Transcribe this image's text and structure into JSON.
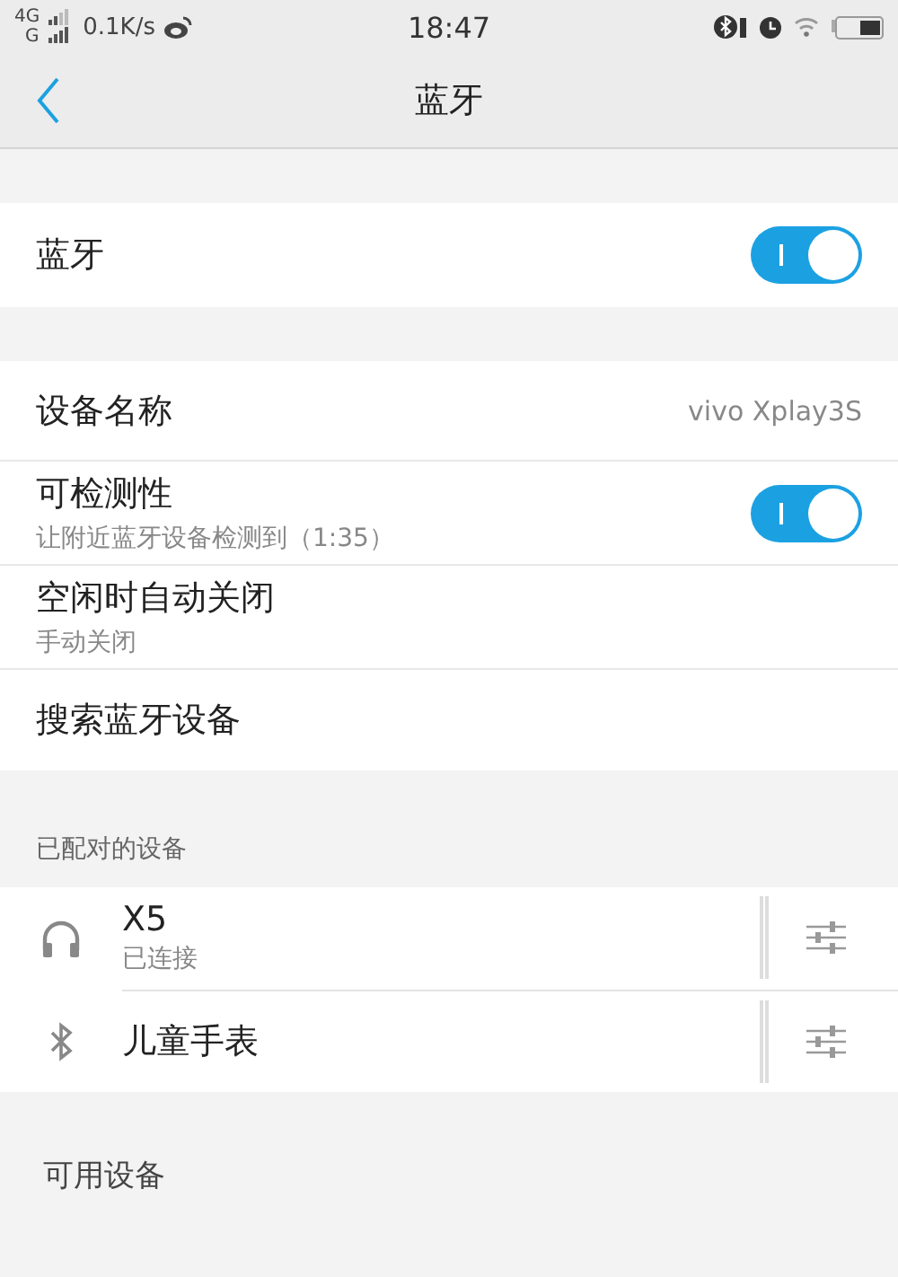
{
  "status_bar": {
    "network_top": "4G",
    "network_bottom": "G",
    "speed": "0.1K/s",
    "time": "18:47"
  },
  "nav": {
    "title": "蓝牙"
  },
  "bluetooth": {
    "label": "蓝牙",
    "on": true
  },
  "settings": [
    {
      "kind": "value",
      "label": "设备名称",
      "value": "vivo Xplay3S"
    },
    {
      "kind": "toggle",
      "label": "可检测性",
      "sub": "让附近蓝牙设备检测到（1:35）",
      "on": true
    },
    {
      "kind": "sub",
      "label": "空闲时自动关闭",
      "sub": "手动关闭"
    },
    {
      "kind": "plain",
      "label": "搜索蓝牙设备"
    }
  ],
  "paired": {
    "header": "已配对的设备",
    "devices": [
      {
        "kind": "headphones",
        "name": "X5",
        "status": "已连接"
      },
      {
        "kind": "bluetooth",
        "name": "儿童手表"
      }
    ]
  },
  "available": {
    "header": "可用设备"
  }
}
